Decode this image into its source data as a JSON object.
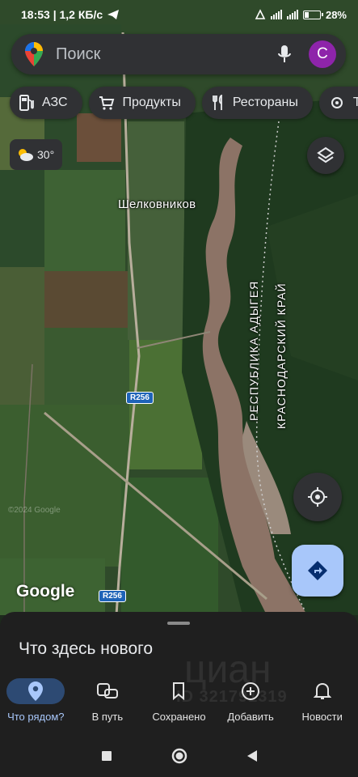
{
  "status_bar": {
    "time_speed": "18:53 | 1,2 КБ/с",
    "battery_percent": "28%",
    "battery_level": 0.28
  },
  "search": {
    "placeholder": "Поиск",
    "avatar_letter": "C"
  },
  "chips": [
    {
      "label": "АЗС",
      "icon": "gas-station-icon"
    },
    {
      "label": "Продукты",
      "icon": "cart-icon"
    },
    {
      "label": "Рестораны",
      "icon": "fork-knife-icon"
    },
    {
      "label": "Т",
      "icon": "attractions-icon"
    }
  ],
  "weather": {
    "temp": "30°",
    "icon": "partly-cloudy-icon"
  },
  "map": {
    "place_label": "Шелковников",
    "region_1": "РЕСПУБЛИКА АДЫГЕЯ",
    "region_2": "КРАСНОДАРСКИЙ КРАЙ",
    "road_1": "R256",
    "road_2": "R256",
    "logo": "Google",
    "copyright": "©2024 Google"
  },
  "sheet": {
    "title": "Что здесь нового"
  },
  "watermark": {
    "brand": "циан",
    "id_text": "ID 321791319"
  },
  "nav": [
    {
      "label": "Что рядом?",
      "icon": "location-pin-icon",
      "active": true
    },
    {
      "label": "В путь",
      "icon": "commute-icon",
      "active": false
    },
    {
      "label": "Сохранено",
      "icon": "bookmark-icon",
      "active": false
    },
    {
      "label": "Добавить",
      "icon": "add-circle-icon",
      "active": false
    },
    {
      "label": "Новости",
      "icon": "bell-icon",
      "active": false
    }
  ],
  "colors": {
    "accent": "#a8c7fa",
    "surface": "#303134",
    "sheet": "#1f1f1f",
    "avatar": "#8e24aa"
  }
}
